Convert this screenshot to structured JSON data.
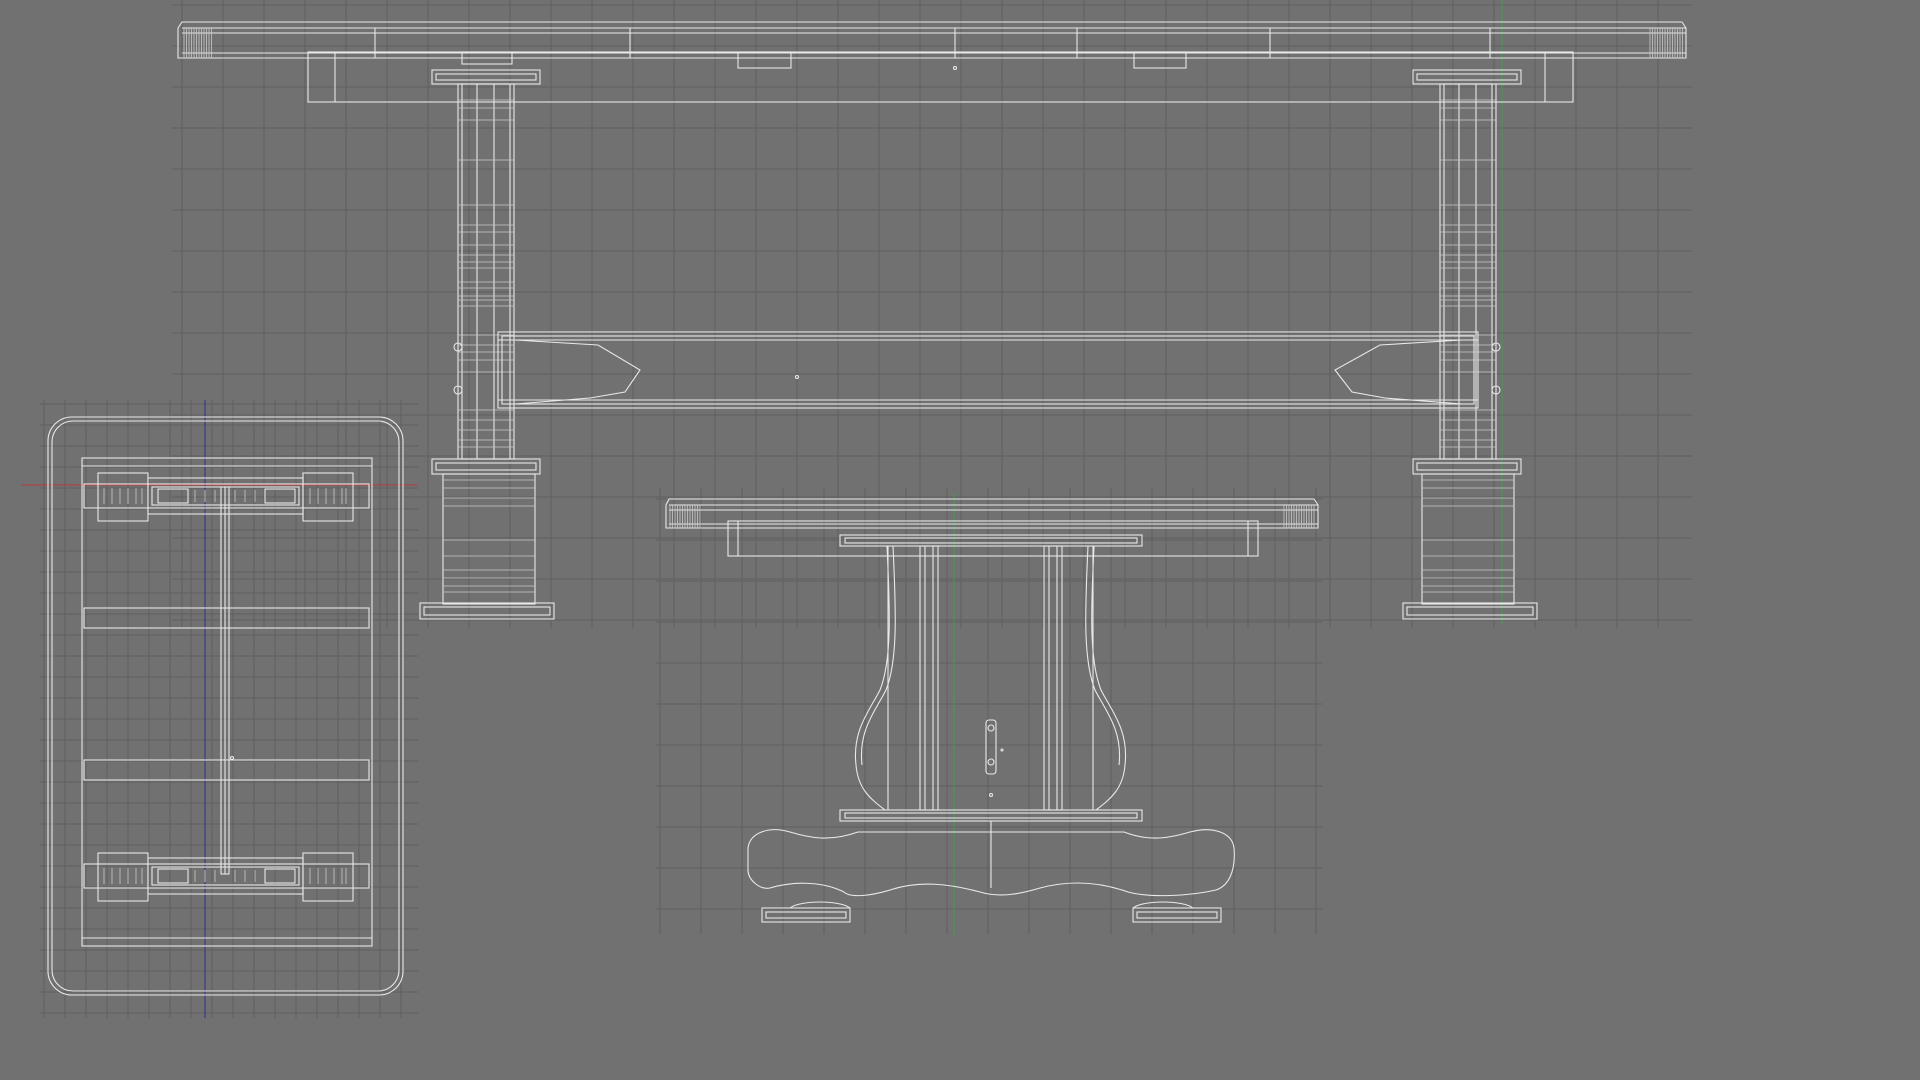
{
  "viewport": {
    "background": "#717171",
    "grid_color": "#5f5f5f",
    "wire_color": "#e9e9e9",
    "wire_color_dim": "#c9c9c9",
    "axis_x_color": "#b33a3a",
    "axis_y_color": "#2f2f8c",
    "axis_z_color": "#3f9f4a"
  },
  "views": [
    {
      "name": "front-view",
      "content": "table-elevation-long"
    },
    {
      "name": "top-view",
      "content": "table-plan"
    },
    {
      "name": "side-view",
      "content": "table-elevation-end"
    }
  ]
}
